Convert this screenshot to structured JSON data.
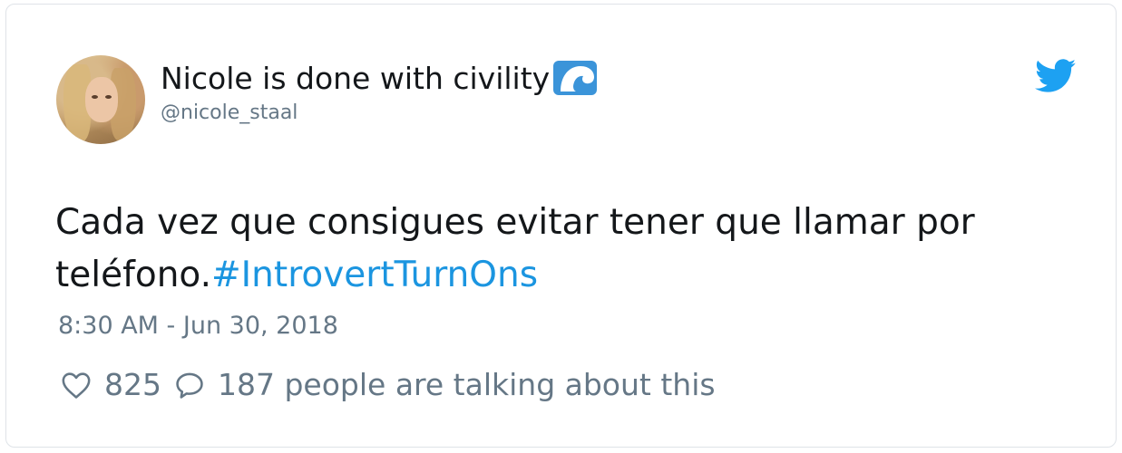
{
  "tweet": {
    "display_name": "Nicole is done with civility",
    "handle": "@nicole_staal",
    "text_main": "Cada vez que consigues evitar tener que llamar por teléfono.",
    "hashtag": "#IntrovertTurnOns",
    "timestamp": "8:30 AM - Jun 30, 2018",
    "likes": "825",
    "replies_text": "187 people are talking about this",
    "icons": {
      "name_emoji": "wave-icon",
      "brand": "twitter-bird-icon",
      "like": "heart-icon",
      "reply": "speech-bubble-icon"
    },
    "colors": {
      "text": "#14171a",
      "secondary": "#657786",
      "link": "#1b95e0",
      "brand": "#1da1f2"
    }
  }
}
